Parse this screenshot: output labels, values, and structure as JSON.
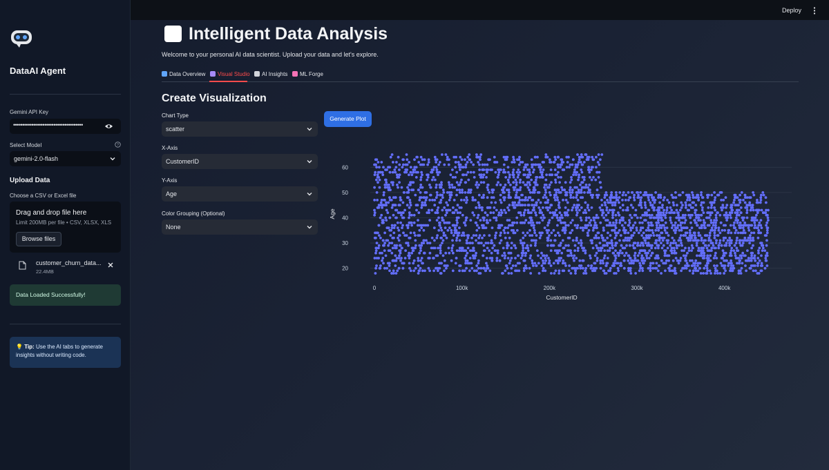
{
  "sidebar": {
    "brand": "DataAI Agent",
    "api_key_label": "Gemini API Key",
    "api_key_value": "••••••••••••••••••••••••••••••••••••••",
    "model_label": "Select Model",
    "model_value": "gemini-2.0-flash",
    "upload_title": "Upload Data",
    "upload_label": "Choose a CSV or Excel file",
    "dropzone_title": "Drag and drop file here",
    "dropzone_sub": "Limit 200MB per file • CSV, XLSX, XLS",
    "browse_label": "Browse files",
    "file_name": "customer_churn_data...",
    "file_size": "22.4MB",
    "success_msg": "Data Loaded Successfully!",
    "tip_bold": "Tip:",
    "tip_text": " Use the AI tabs to generate insights without writing code."
  },
  "header": {
    "deploy_label": "Deploy"
  },
  "main": {
    "title": "Intelligent Data Analysis",
    "welcome": "Welcome to your personal AI data scientist. Upload your data and let's explore.",
    "tabs": [
      {
        "label": "Data Overview",
        "icon_color": "#60a5fa"
      },
      {
        "label": "Visual Studio",
        "icon_color": "#a78bfa",
        "active": true
      },
      {
        "label": "AI Insights",
        "icon_color": "#d1d5db"
      },
      {
        "label": "ML Forge",
        "icon_color": "#f472b6"
      }
    ],
    "section_title": "Create Visualization",
    "chart_type_label": "Chart Type",
    "chart_type_value": "scatter",
    "x_axis_label": "X-Axis",
    "x_axis_value": "CustomerID",
    "y_axis_label": "Y-Axis",
    "y_axis_value": "Age",
    "color_label": "Color Grouping (Optional)",
    "color_value": "None",
    "generate_label": "Generate Plot"
  },
  "chart_data": {
    "type": "scatter",
    "xlabel": "CustomerID",
    "ylabel": "Age",
    "xlim": [
      0,
      450000
    ],
    "ylim": [
      18,
      65
    ],
    "x_ticks": [
      0,
      100000,
      200000,
      300000,
      400000
    ],
    "x_tick_labels": [
      "0",
      "100k",
      "200k",
      "300k",
      "400k"
    ],
    "y_ticks": [
      20,
      30,
      40,
      50,
      60
    ],
    "y_tick_labels": [
      "20",
      "30",
      "40",
      "50",
      "60"
    ],
    "grid": true,
    "marker_color": "#636efa",
    "regions": [
      {
        "x_range": [
          0,
          260000
        ],
        "y_range": [
          18,
          65
        ]
      },
      {
        "x_range": [
          260000,
          450000
        ],
        "y_range": [
          18,
          50
        ]
      }
    ]
  }
}
